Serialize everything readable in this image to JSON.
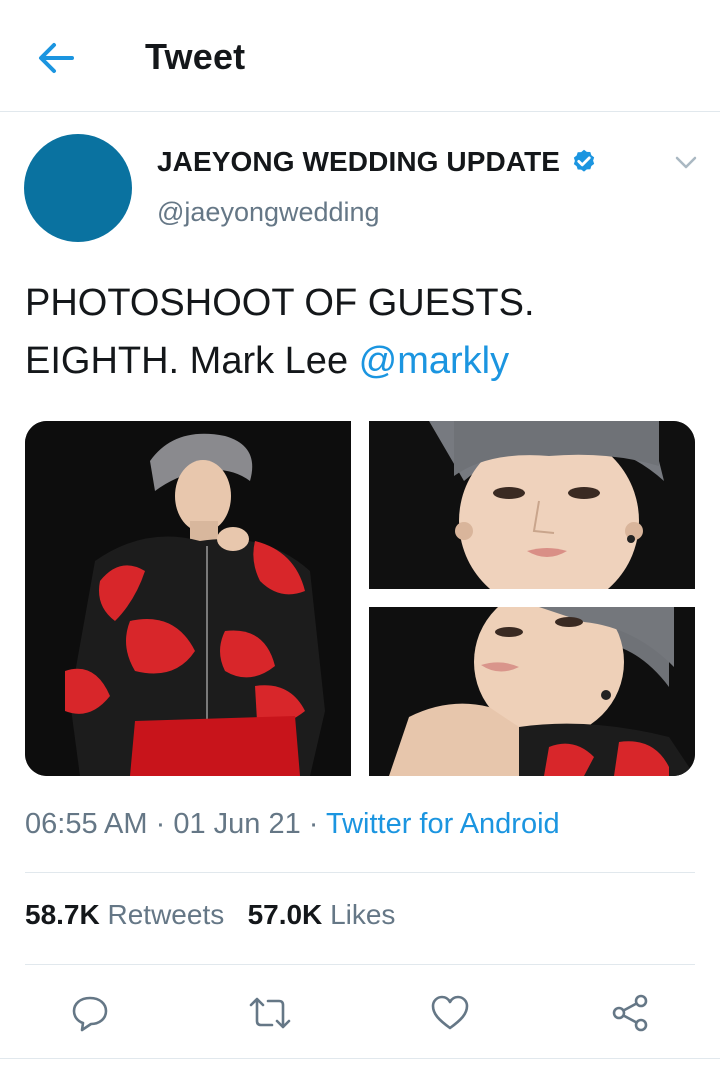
{
  "header": {
    "title": "Tweet",
    "back_icon": "arrow-left-icon"
  },
  "author": {
    "name": "JAEYONG WEDDING UPDATE",
    "handle": "@jaeyongwedding",
    "verified_icon": "verified-badge-icon",
    "avatar_color": "#0a72a0"
  },
  "tweet": {
    "line1": "PHOTOSHOOT OF GUESTS.",
    "line2_prefix": "EIGHTH. Mark Lee ",
    "mention": "@markly"
  },
  "media": [
    {
      "alt": "photo-1"
    },
    {
      "alt": "photo-2"
    },
    {
      "alt": "photo-3"
    }
  ],
  "meta": {
    "time": "06:55 AM",
    "sep1": " · ",
    "date": "01 Jun 21",
    "sep2": " · ",
    "source": "Twitter for Android"
  },
  "stats": {
    "retweets_count": "58.7K",
    "retweets_label": "Retweets",
    "likes_count": "57.0K",
    "likes_label": "Likes"
  },
  "actions": [
    "reply-icon",
    "retweet-icon",
    "like-icon",
    "share-icon"
  ],
  "colors": {
    "accent": "#1b95e0",
    "muted": "#657786",
    "text": "#14171a",
    "divider": "#e1e8ed"
  }
}
